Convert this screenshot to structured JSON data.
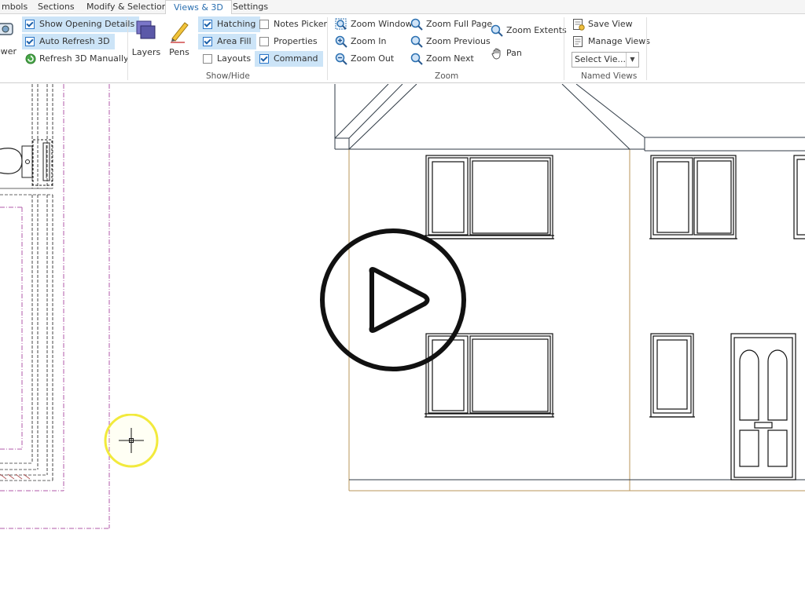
{
  "tabs": [
    {
      "label": "mbols",
      "active": false
    },
    {
      "label": "Sections",
      "active": false
    },
    {
      "label": "Modify & Selection",
      "active": false
    },
    {
      "label": "Views & 3D",
      "active": true
    },
    {
      "label": "Settings",
      "active": false
    }
  ],
  "ribbon": {
    "viewer_partial": "ewer",
    "show_opening_details": "Show Opening Details",
    "auto_refresh_3d": "Auto Refresh 3D",
    "refresh_3d_manually": "Refresh 3D Manually",
    "layers": "Layers",
    "pens": "Pens",
    "hatching": "Hatching",
    "area_fill": "Area Fill",
    "layouts": "Layouts",
    "notes_picker": "Notes Picker",
    "properties": "Properties",
    "command": "Command",
    "show_hide_label": "Show/Hide",
    "zoom_window": "Zoom Window",
    "zoom_in": "Zoom In",
    "zoom_out": "Zoom Out",
    "zoom_full_page": "Zoom Full Page",
    "zoom_previous": "Zoom Previous",
    "zoom_next": "Zoom Next",
    "zoom_extents": "Zoom Extents",
    "pan": "Pan",
    "zoom_label": "Zoom",
    "save_view": "Save View",
    "manage_views": "Manage Views",
    "select_view": "Select Vie...",
    "named_views_label": "Named Views"
  },
  "checkboxes": {
    "show_opening_details": true,
    "auto_refresh_3d": true,
    "hatching": true,
    "area_fill": true,
    "layouts": false,
    "notes_picker": false,
    "properties": false,
    "command": true
  },
  "colors": {
    "accent": "#2a6fb0",
    "highlight": "#cce4f7",
    "plan_magenta": "#b05aa8",
    "elevation_line": "#2f3a45",
    "ground_line": "#b8955a"
  }
}
